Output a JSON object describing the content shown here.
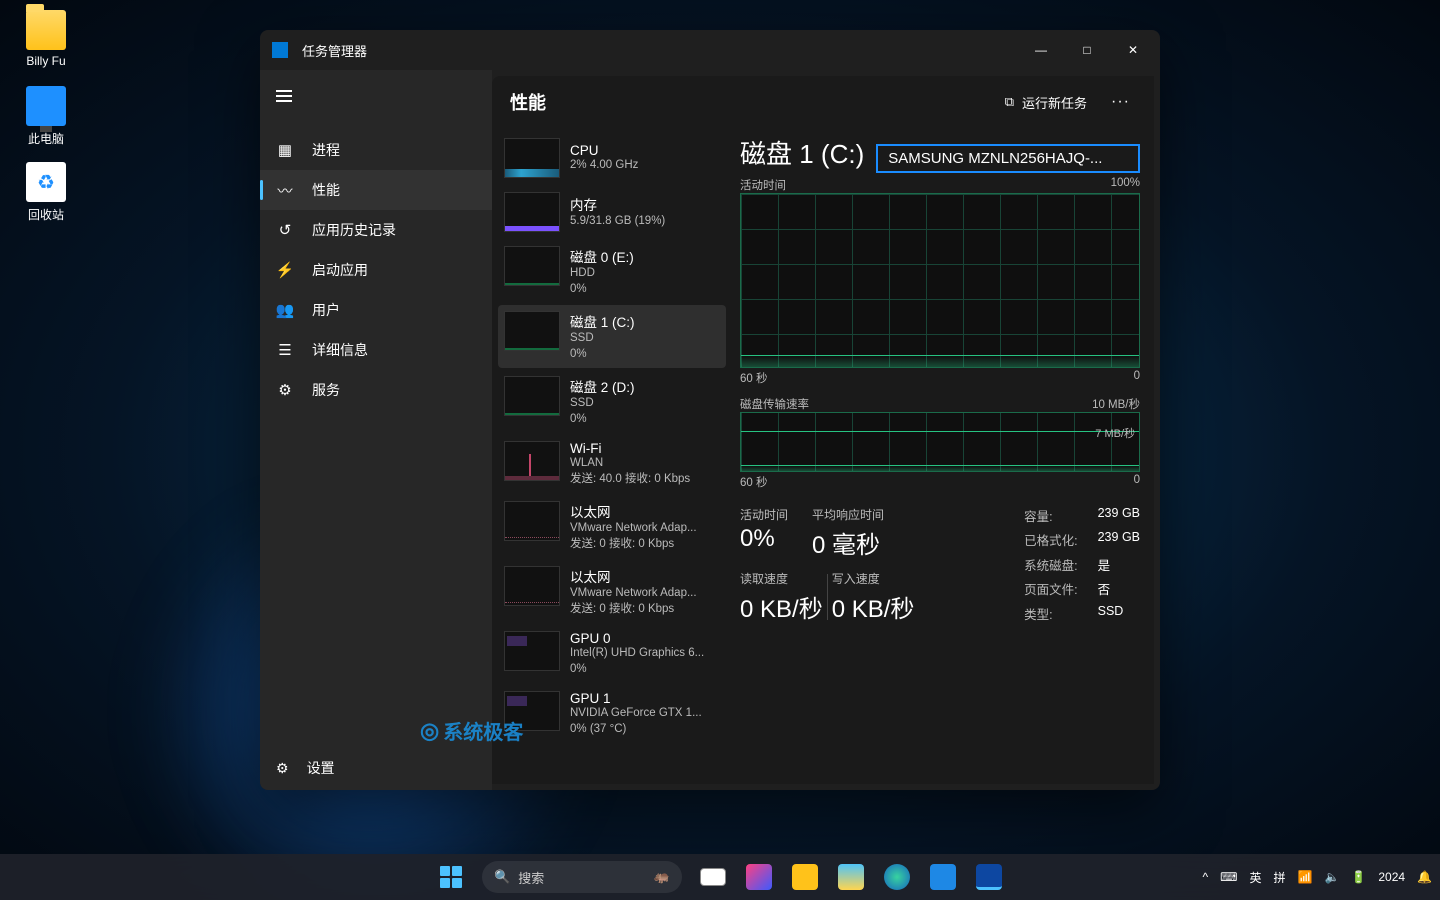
{
  "desktop": {
    "icons": [
      {
        "name": "Billy Fu"
      },
      {
        "name": "此电脑"
      },
      {
        "name": "回收站"
      }
    ]
  },
  "window": {
    "app_title": "任务管理器",
    "min_tip": "—",
    "max_tip": "□",
    "close_tip": "✕",
    "run_task": "运行新任务",
    "more": "···"
  },
  "sidebar": {
    "items": [
      {
        "icon": "▦",
        "label": "进程"
      },
      {
        "icon": "〰",
        "label": "性能"
      },
      {
        "icon": "↺",
        "label": "应用历史记录"
      },
      {
        "icon": "⚡",
        "label": "启动应用"
      },
      {
        "icon": "👥",
        "label": "用户"
      },
      {
        "icon": "☰",
        "label": "详细信息"
      },
      {
        "icon": "⚙",
        "label": "服务"
      }
    ],
    "active_index": 1,
    "settings_label": "设置",
    "settings_icon": "⚙"
  },
  "page_title": "性能",
  "perf_list": [
    {
      "title": "CPU",
      "sub1": "2% 4.00 GHz",
      "sub2": "",
      "thumb": "cpu"
    },
    {
      "title": "内存",
      "sub1": "5.9/31.8 GB (19%)",
      "sub2": "",
      "thumb": "mem"
    },
    {
      "title": "磁盘 0 (E:)",
      "sub1": "HDD",
      "sub2": "0%",
      "thumb": "disk",
      "arrow": true
    },
    {
      "title": "磁盘 1 (C:)",
      "sub1": "SSD",
      "sub2": "0%",
      "thumb": "disk",
      "arrow": true,
      "selected": true
    },
    {
      "title": "磁盘 2 (D:)",
      "sub1": "SSD",
      "sub2": "0%",
      "thumb": "disk",
      "arrow": true
    },
    {
      "title": "Wi-Fi",
      "sub1": "WLAN",
      "sub2": "发送: 40.0 接收: 0 Kbps",
      "thumb": "wifi"
    },
    {
      "title": "以太网",
      "sub1": "VMware Network Adap...",
      "sub2": "发送: 0 接收: 0 Kbps",
      "thumb": "eth"
    },
    {
      "title": "以太网",
      "sub1": "VMware Network Adap...",
      "sub2": "发送: 0 接收: 0 Kbps",
      "thumb": "eth"
    },
    {
      "title": "GPU 0",
      "sub1": "Intel(R) UHD Graphics 6...",
      "sub2": "0%",
      "thumb": "gpu"
    },
    {
      "title": "GPU 1",
      "sub1": "NVIDIA GeForce GTX 1...",
      "sub2": "0% (37 °C)",
      "thumb": "gpu"
    }
  ],
  "detail": {
    "title": "磁盘 1 (C:)",
    "model": "SAMSUNG MZNLN256HAJQ-...",
    "activity_label": "活动时间",
    "activity_max": "100%",
    "time_axis_left": "60 秒",
    "time_axis_right": "0",
    "transfer_label": "磁盘传输速率",
    "transfer_max": "10 MB/秒",
    "transfer_mid": "7 MB/秒",
    "stats": {
      "activity_k": "活动时间",
      "activity_v": "0%",
      "response_k": "平均响应时间",
      "response_v": "0 毫秒",
      "read_k": "读取速度",
      "read_v": "0 KB/秒",
      "write_k": "写入速度",
      "write_v": "0 KB/秒"
    },
    "props": [
      [
        "容量:",
        "239 GB"
      ],
      [
        "已格式化:",
        "239 GB"
      ],
      [
        "系统磁盘:",
        "是"
      ],
      [
        "页面文件:",
        "否"
      ],
      [
        "类型:",
        "SSD"
      ]
    ]
  },
  "watermark": "系统极客",
  "taskbar": {
    "search_placeholder": "搜索",
    "tray": {
      "ime1": "英",
      "ime2": "拼",
      "year": "2024"
    }
  }
}
